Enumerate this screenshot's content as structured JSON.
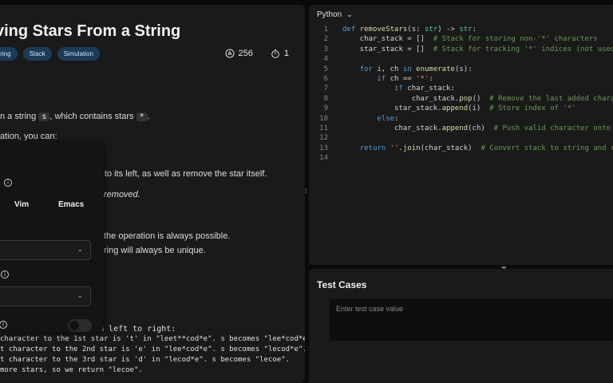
{
  "problem": {
    "title": "ving Stars From a String",
    "tags": [
      "tring",
      "Stack",
      "Simulation"
    ],
    "likes": "256",
    "comments": "1",
    "desc_line1_pre": "n a string ",
    "desc_line1_code1": "s",
    "desc_line1_mid": ", which contains stars ",
    "desc_line1_code2": "*",
    "desc_line1_post": ".",
    "desc_line2": "ation, you can:",
    "desc_line3": "er to its left, as well as remove the star itself.",
    "desc_line4": "removed.",
    "desc_line5": "the operation is always possible.",
    "desc_line6": "ring will always be unique.",
    "expl_0": "om left to right:",
    "expl_1": "  character to the 1st star is 't' in \"leet**cod*e\". s becomes \"lee*cod*e\".",
    "expl_2": "t character to the 2nd star is 'e' in \"lee*cod*e\". s becomes \"lecod*e\".",
    "expl_3": "t character to the 3rd star is 'd' in \"lecod*e\". s becomes \"lecoe\".",
    "expl_4": " more stars, so we return \"lecoe\"."
  },
  "popup": {
    "option_vim": "Vim",
    "option_emacs": "Emacs",
    "info_glyph": "i"
  },
  "editor": {
    "language": "Python",
    "lines": [
      {
        "n": "1"
      },
      {
        "n": "2"
      },
      {
        "n": "3"
      },
      {
        "n": "4"
      },
      {
        "n": "5"
      },
      {
        "n": "6"
      },
      {
        "n": "7"
      },
      {
        "n": "8"
      },
      {
        "n": "9"
      },
      {
        "n": "10"
      },
      {
        "n": "11"
      },
      {
        "n": "12"
      },
      {
        "n": "13"
      },
      {
        "n": "14"
      }
    ]
  },
  "tests": {
    "title": "Test Cases",
    "placeholder": "Enter test case value"
  },
  "colors": {
    "tag_bg": "#1d3a57",
    "keyword": "#569cd6",
    "comment": "#6a9955",
    "function": "#dcdcaa"
  }
}
